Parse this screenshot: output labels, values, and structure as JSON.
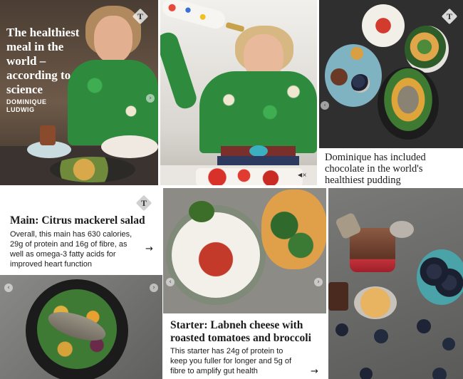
{
  "tile1": {
    "headline": "The healthiest meal in the world – according to science",
    "author": "DOMINIQUE LUDWIG",
    "logo_glyph": "T",
    "nav_glyph": "›"
  },
  "tile2": {
    "sound_glyph": "◀×"
  },
  "tile3": {
    "logo_glyph": "T",
    "nav_glyph": "‹",
    "caption": "Dominique has included chocolate in the world's healthiest pudding"
  },
  "tile4": {
    "title": "Main: Citrus mackerel salad",
    "body": "Overall, this main has 630 calories, 29g of protein and 16g of fibre, as well as omega-3 fatty acids for improved heart function",
    "arrow": "→",
    "logo_glyph": "T"
  },
  "tile5": {
    "nav_prev": "‹",
    "nav_next": "›"
  },
  "tile6": {
    "nav_prev": "‹",
    "nav_next": "›",
    "title": "Starter: Labneh cheese with roasted tomatoes and broccoli",
    "body": "This starter has 24g of protein to keep you fuller for longer and 5g of fibre to amplify gut health",
    "arrow": "→"
  },
  "colors": {
    "accent_green": "#2e8b3e",
    "dark_stone": "#2f2f2f",
    "text": "#1b1b1b"
  }
}
